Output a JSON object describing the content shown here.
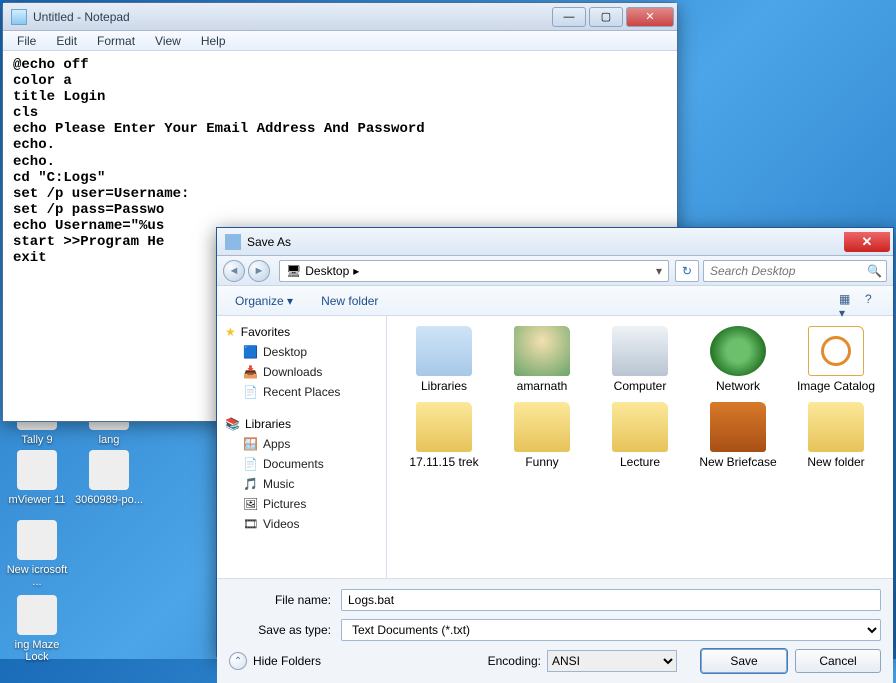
{
  "desktop": {
    "icons": [
      "Tally 9",
      "lang",
      "mViewer 11",
      "3060989-po...",
      "New icrosoft ...",
      "ing Maze Lock"
    ]
  },
  "notepad": {
    "title": "Untitled - Notepad",
    "menu": [
      "File",
      "Edit",
      "Format",
      "View",
      "Help"
    ],
    "content": "@echo off\ncolor a\ntitle Login\ncls\necho Please Enter Your Email Address And Password\necho.\necho.\ncd \"C:Logs\"\nset /p user=Username:\nset /p pass=Passwo\necho Username=\"%us\nstart >>Program He\nexit",
    "controls": {
      "min": "—",
      "max": "▢",
      "close": "✕"
    }
  },
  "save_dialog": {
    "title": "Save As",
    "close": "✕",
    "nav": {
      "back": "◄",
      "forward": "►"
    },
    "breadcrumb": {
      "location": "Desktop",
      "arrow": "▸"
    },
    "refresh": "↻",
    "search_placeholder": "Search Desktop",
    "toolbar": {
      "organize": "Organize ▾",
      "new_folder": "New folder",
      "help": "?"
    },
    "navpane": {
      "favorites": {
        "label": "Favorites",
        "items": [
          "Desktop",
          "Downloads",
          "Recent Places"
        ]
      },
      "libraries": {
        "label": "Libraries",
        "items": [
          "Apps",
          "Documents",
          "Music",
          "Pictures",
          "Videos"
        ]
      }
    },
    "nav_icons": {
      "Desktop": "🟦",
      "Downloads": "📥",
      "Recent Places": "📄",
      "Apps": "🪟",
      "Documents": "📄",
      "Music": "🎵",
      "Pictures": "🖼",
      "Videos": "🎞"
    },
    "files": [
      {
        "name": "Libraries",
        "kind": "special"
      },
      {
        "name": "amarnath",
        "kind": "user"
      },
      {
        "name": "Computer",
        "kind": "comp"
      },
      {
        "name": "Network",
        "kind": "net"
      },
      {
        "name": "Image Catalog",
        "kind": "cat"
      },
      {
        "name": "17.11.15 trek",
        "kind": "folder"
      },
      {
        "name": "Funny",
        "kind": "folder"
      },
      {
        "name": "Lecture",
        "kind": "folder"
      },
      {
        "name": "New Briefcase",
        "kind": "brief"
      },
      {
        "name": "New folder",
        "kind": "folder"
      }
    ],
    "file_name_label": "File name:",
    "file_name_value": "Logs.bat",
    "save_type_label": "Save as type:",
    "save_type_value": "Text Documents (*.txt)",
    "hide_folders": "Hide Folders",
    "hide_folders_arrow": "⌃",
    "encoding_label": "Encoding:",
    "encoding_value": "ANSI",
    "save_button": "Save",
    "cancel_button": "Cancel"
  }
}
